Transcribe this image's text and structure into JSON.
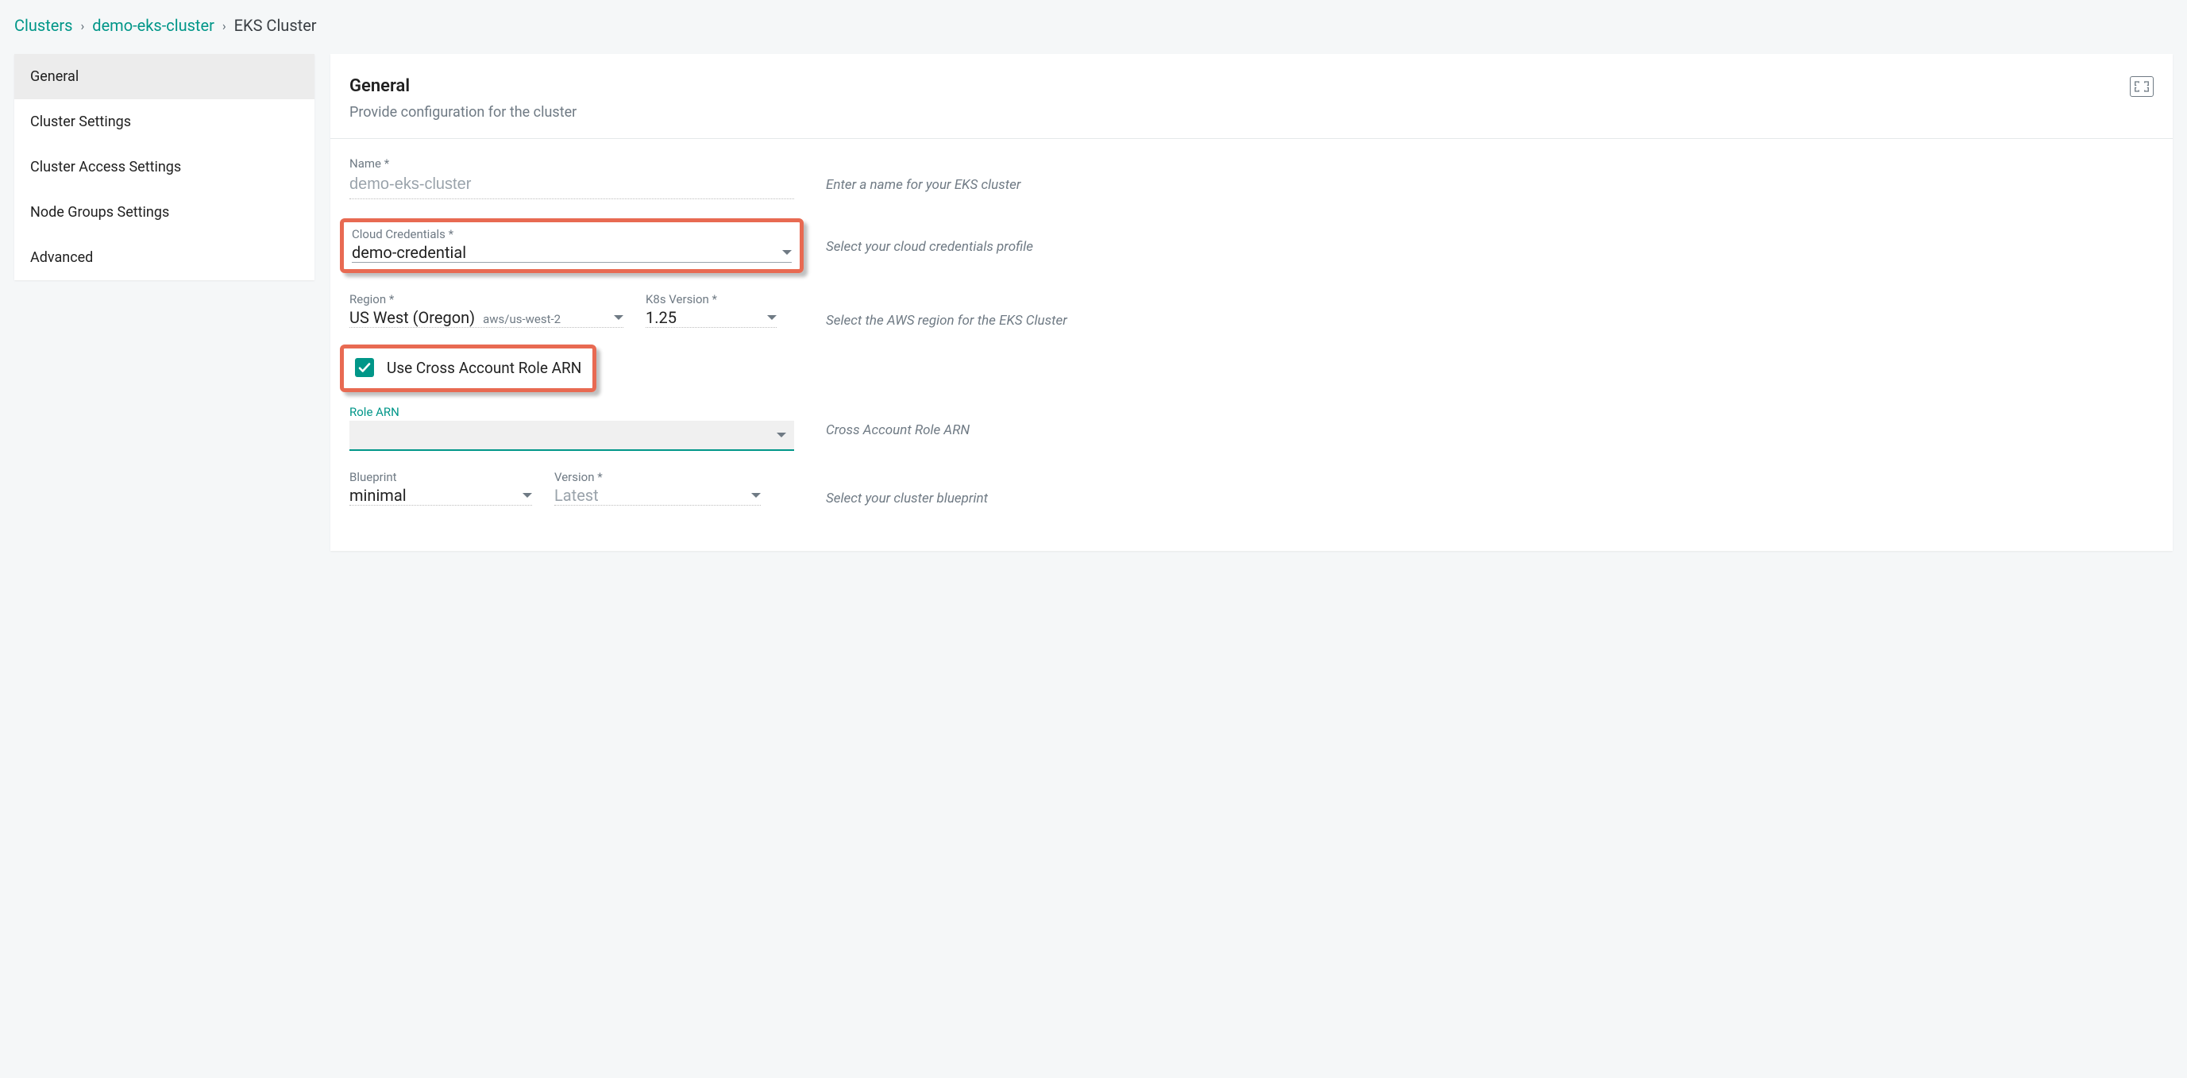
{
  "breadcrumb": {
    "root": "Clusters",
    "cluster": "demo-eks-cluster",
    "page": "EKS Cluster"
  },
  "sidebar": {
    "items": [
      {
        "label": "General",
        "active": true
      },
      {
        "label": "Cluster Settings",
        "active": false
      },
      {
        "label": "Cluster Access Settings",
        "active": false
      },
      {
        "label": "Node Groups Settings",
        "active": false
      },
      {
        "label": "Advanced",
        "active": false
      }
    ]
  },
  "section": {
    "title": "General",
    "subtitle": "Provide configuration for the cluster"
  },
  "fields": {
    "name": {
      "label": "Name *",
      "value": "demo-eks-cluster",
      "hint": "Enter a name for your EKS cluster"
    },
    "cloud_credentials": {
      "label": "Cloud Credentials *",
      "value": "demo-credential",
      "hint": "Select your cloud credentials profile"
    },
    "region": {
      "label": "Region *",
      "value": "US West (Oregon)",
      "sub": "aws/us-west-2"
    },
    "k8s_version": {
      "label": "K8s Version *",
      "value": "1.25"
    },
    "region_hint": "Select the AWS region for the EKS Cluster",
    "cross_account": {
      "label": "Use Cross Account Role ARN",
      "checked": true
    },
    "role_arn": {
      "label": "Role ARN",
      "value": "",
      "hint": "Cross Account Role ARN"
    },
    "blueprint": {
      "label": "Blueprint",
      "value": "minimal"
    },
    "version": {
      "label": "Version *",
      "value": "Latest"
    },
    "blueprint_hint": "Select your cluster blueprint"
  }
}
